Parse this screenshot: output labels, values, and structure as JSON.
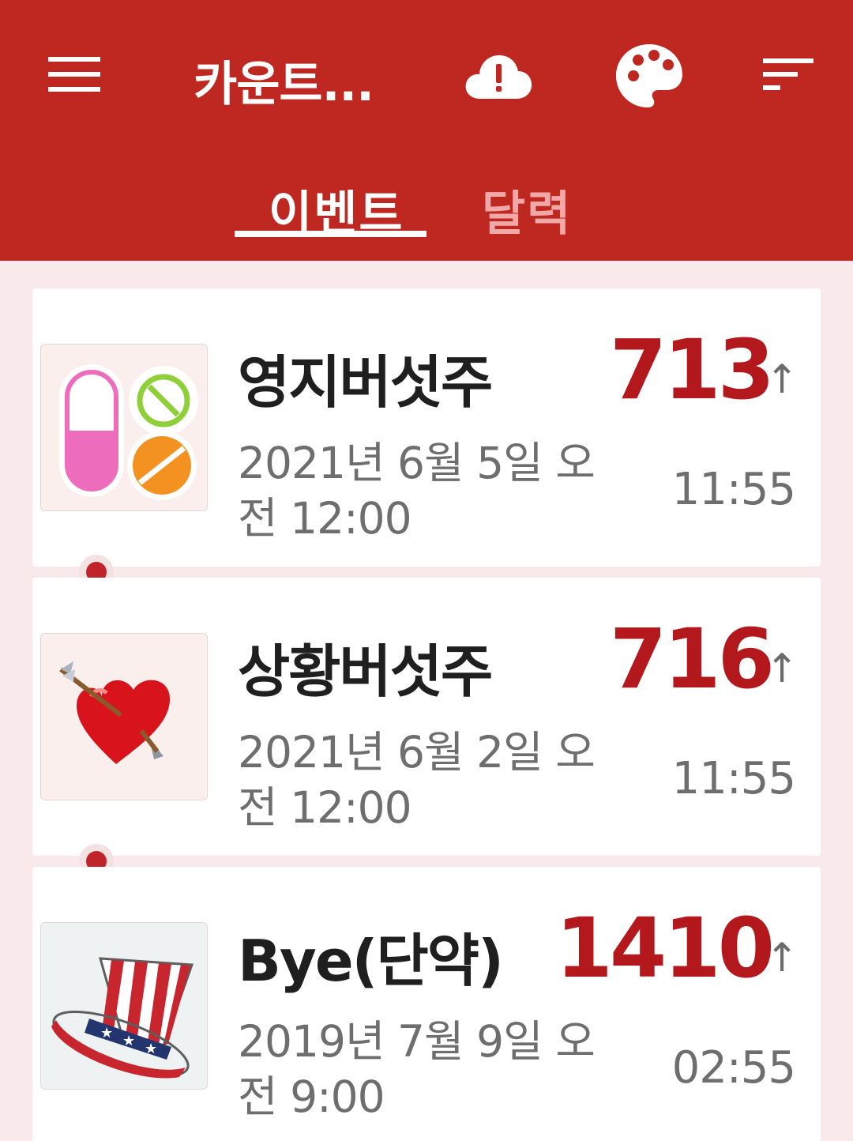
{
  "appbar": {
    "title": "카운트...",
    "background": "#bf2821",
    "icons": [
      "menu-icon",
      "cloud-alert-icon",
      "palette-icon",
      "sort-icon"
    ]
  },
  "tabs": [
    {
      "label": "이벤트",
      "active": true
    },
    {
      "label": "달력",
      "active": false
    }
  ],
  "events": [
    {
      "title": "영지버섯주",
      "count": "713",
      "date": "2021년 6월 5일 오전 12:00",
      "time": "11:55",
      "icon": "pills-icon"
    },
    {
      "title": "상황버섯주",
      "count": "716",
      "date": "2021년 6월 2일 오전 12:00",
      "time": "11:55",
      "icon": "heart-arrow-icon"
    },
    {
      "title": "Bye(단약)",
      "count": "1410",
      "date": "2019년 7월 9일 오전 9:00",
      "time": "02:55",
      "icon": "uncle-sam-hat-icon"
    }
  ],
  "count_direction_glyph": "↑",
  "colors": {
    "accent": "#bf2821",
    "count": "#b3181d",
    "background": "#f9e9ea"
  }
}
